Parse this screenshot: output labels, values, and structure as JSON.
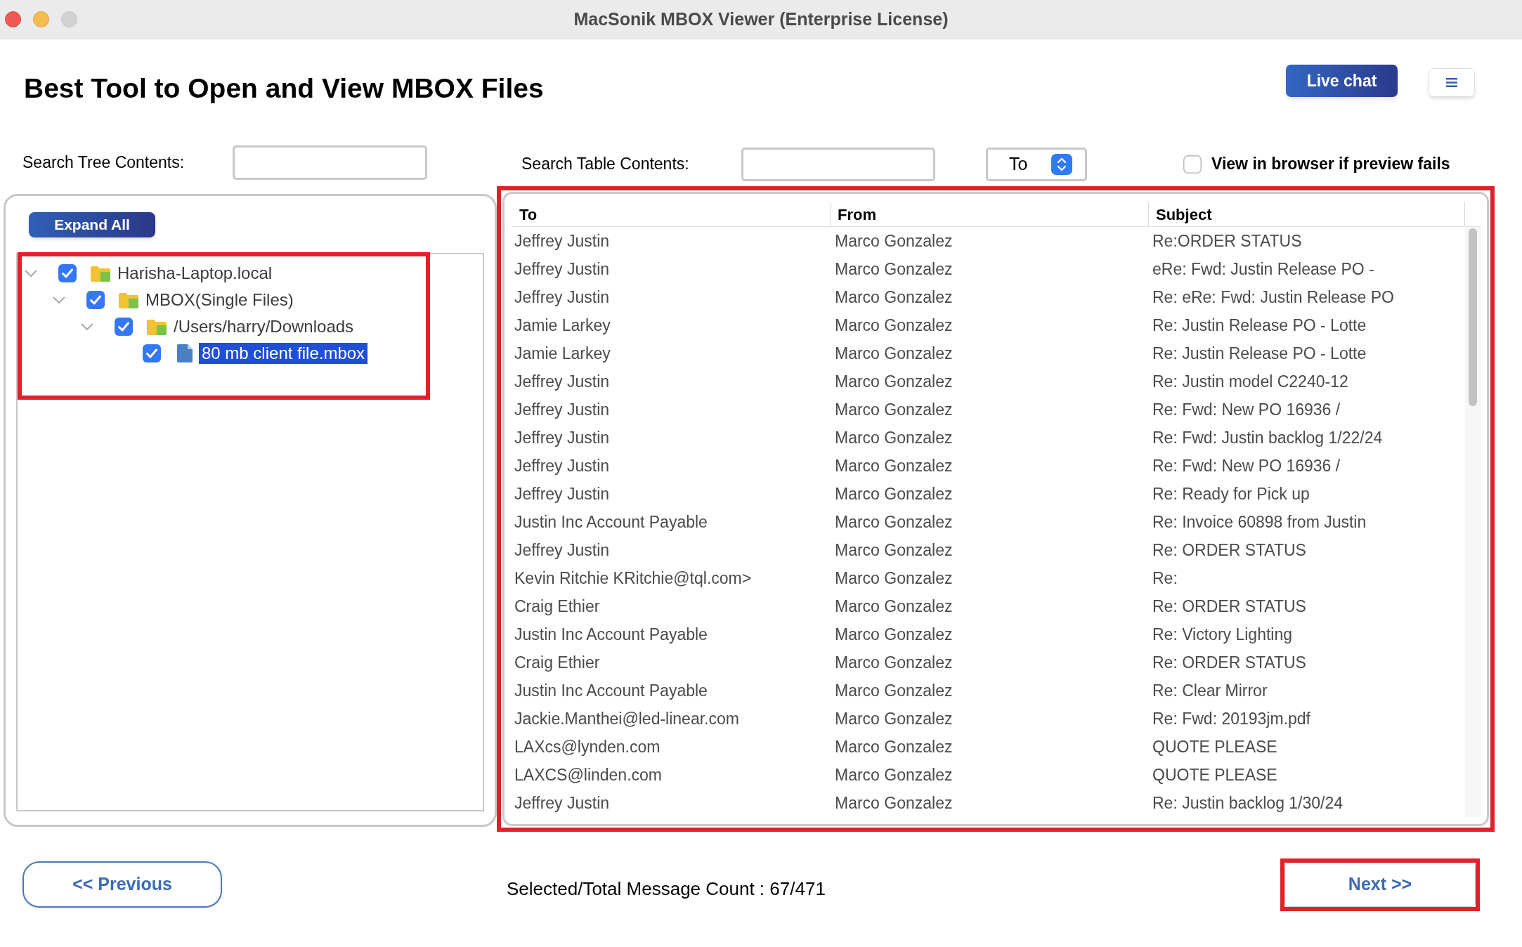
{
  "window": {
    "title": "MacSonik MBOX Viewer (Enterprise License)"
  },
  "header": {
    "title": "Best Tool to Open and View MBOX Files",
    "live_chat_button": "Live chat"
  },
  "tree_search": {
    "label": "Search Tree Contents:"
  },
  "table_search": {
    "label": "Search Table Contents:",
    "column_select": "To"
  },
  "preview_option": {
    "label": "View in browser if preview fails",
    "checked": false
  },
  "tree": {
    "expand_button": "Expand All",
    "highlighted": true,
    "nodes": [
      {
        "label": "Harisha-Laptop.local",
        "kind": "folder",
        "checked": true,
        "expanded": true,
        "selected": false,
        "children": [
          {
            "label": "MBOX(Single Files)",
            "kind": "folder",
            "checked": true,
            "expanded": true,
            "selected": false,
            "children": [
              {
                "label": "/Users/harry/Downloads",
                "kind": "folder",
                "checked": true,
                "expanded": true,
                "selected": false,
                "children": [
                  {
                    "label": "80 mb client file.mbox",
                    "kind": "file",
                    "checked": true,
                    "selected": true
                  }
                ]
              }
            ]
          }
        ]
      }
    ]
  },
  "table": {
    "highlighted": true,
    "columns": [
      "To",
      "From",
      "Subject"
    ],
    "rows": [
      [
        "Jeffrey Justin",
        "Marco Gonzalez",
        "Re:ORDER STATUS"
      ],
      [
        "Jeffrey Justin",
        "Marco Gonzalez",
        "eRe: Fwd: Justin Release PO -"
      ],
      [
        "Jeffrey Justin",
        "Marco Gonzalez",
        "Re: eRe: Fwd: Justin Release PO"
      ],
      [
        "Jamie Larkey",
        "Marco Gonzalez",
        "Re: Justin Release PO - Lotte"
      ],
      [
        "Jamie Larkey",
        "Marco Gonzalez",
        "Re: Justin Release PO - Lotte"
      ],
      [
        "Jeffrey Justin",
        "Marco Gonzalez",
        "Re: Justin model C2240-12"
      ],
      [
        "Jeffrey Justin",
        "Marco Gonzalez",
        "Re: Fwd: New PO 16936 /"
      ],
      [
        "Jeffrey Justin",
        "Marco Gonzalez",
        "Re: Fwd: Justin backlog 1/22/24"
      ],
      [
        "Jeffrey Justin",
        "Marco Gonzalez",
        "Re: Fwd: New PO 16936 /"
      ],
      [
        "Jeffrey Justin",
        "Marco Gonzalez",
        "Re: Ready for Pick up"
      ],
      [
        "Justin Inc Account Payable",
        "Marco Gonzalez",
        "Re: Invoice 60898 from Justin"
      ],
      [
        "Jeffrey Justin",
        "Marco Gonzalez",
        "Re: ORDER STATUS"
      ],
      [
        "Kevin Ritchie KRitchie@tql.com>",
        "Marco Gonzalez",
        "Re:"
      ],
      [
        "Craig Ethier",
        "Marco Gonzalez",
        "Re: ORDER STATUS"
      ],
      [
        "Justin Inc Account Payable",
        "Marco Gonzalez",
        "Re: Victory Lighting"
      ],
      [
        "Craig Ethier",
        "Marco Gonzalez",
        "Re: ORDER STATUS"
      ],
      [
        "Justin Inc Account Payable",
        "Marco Gonzalez",
        "Re: Clear Mirror"
      ],
      [
        "Jackie.Manthei@led-linear.com",
        "Marco Gonzalez",
        "Re: Fwd: 20193jm.pdf"
      ],
      [
        "LAXcs@lynden.com",
        "Marco Gonzalez",
        "QUOTE PLEASE"
      ],
      [
        "LAXCS@linden.com",
        "Marco Gonzalez",
        "QUOTE PLEASE"
      ],
      [
        "Jeffrey Justin",
        "Marco Gonzalez",
        "Re: Justin backlog 1/30/24"
      ]
    ]
  },
  "footer": {
    "previous_button": {
      "label": "<< Previous"
    },
    "message_count": "Selected/Total Message Count : 67/471",
    "next_button": {
      "label": "Next >>",
      "highlighted": true
    }
  }
}
